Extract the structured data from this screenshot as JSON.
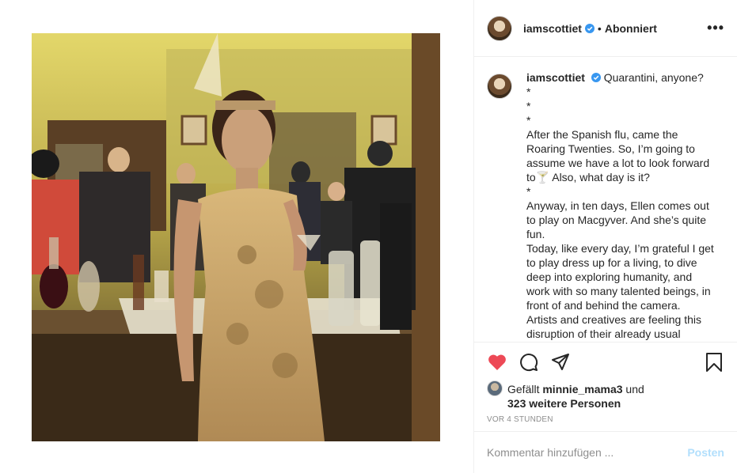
{
  "post": {
    "image_alt": "",
    "username": "iamscottiet",
    "follow_status": "Abonniert",
    "more_icon": "more-horizontal-icon"
  },
  "caption": {
    "username": "iamscottiet",
    "lines": [
      "Quarantini, anyone?",
      "*",
      "*",
      "*",
      "After the Spanish flu, came the",
      "Roaring Twenties. So, I’m going to",
      "assume we have a lot to look forward",
      "to🍸 Also, what day is it?",
      "*",
      "Anyway, in ten days, Ellen comes out",
      "to play on Macgyver. And she’s quite",
      "fun.",
      "Today, like every day, I’m grateful I get",
      "to play dress up for a living, to dive",
      "deep into exploring humanity, and",
      "work with so many talented beings, in",
      "front of and behind the camera.",
      "Artists and creatives are feeling this",
      "disruption of their already usual"
    ]
  },
  "actions": {
    "like_icon": "heart-filled-icon",
    "comment_icon": "comment-icon",
    "share_icon": "share-icon",
    "save_icon": "bookmark-icon",
    "like_color": "#ed4956"
  },
  "likes": {
    "prefix": "Gefällt",
    "first_liker": "minnie_mama3",
    "connector": "und",
    "others": "323 weitere Personen"
  },
  "timestamp": "VOR 4 STUNDEN",
  "comment_box": {
    "placeholder": "Kommentar hinzufügen ...",
    "post_label": "Posten",
    "post_color": "#b2dffc"
  }
}
